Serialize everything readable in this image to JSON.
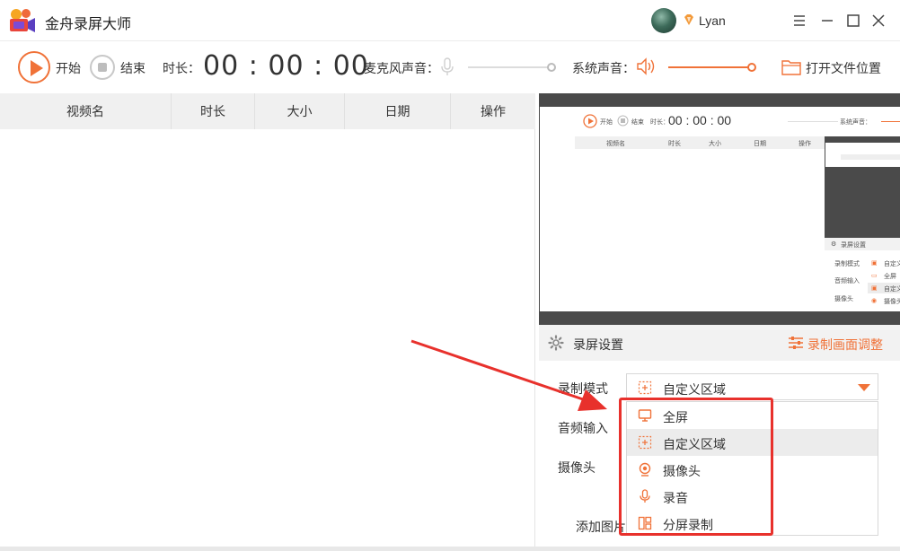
{
  "app": {
    "title": "金舟录屏大师"
  },
  "user": {
    "name": "Lyan"
  },
  "toolbar": {
    "start_label": "开始",
    "stop_label": "结束",
    "duration_label": "时长：",
    "duration_value": "00 : 00 : 00",
    "mic_label": "麦克风声音：",
    "mic_level": 0.0,
    "system_sound_label": "系统声音：",
    "system_level": 1.0,
    "open_folder_label": "打开文件位置"
  },
  "table": {
    "columns": [
      "视频名",
      "时长",
      "大小",
      "日期",
      "操作"
    ]
  },
  "preview": {
    "duration_value": "00 : 00 : 00",
    "start_label": "开始",
    "stop_label": "结束",
    "duration_label": "时长：",
    "system_label": "系统声音：",
    "columns": [
      "视频名",
      "时长",
      "大小",
      "日期",
      "操作"
    ],
    "settings_title": "录屏设置",
    "mode_label": "录制模式",
    "audio_label": "音频输入",
    "camera_label": "摄像头",
    "options": [
      "自定义区域",
      "全屏",
      "自定义区域",
      "摄像头"
    ]
  },
  "settings": {
    "title": "录屏设置",
    "adjust_label": "录制画面调整",
    "mode_label": "录制模式",
    "audio_label": "音频输入",
    "camera_label": "摄像头",
    "add_image_label": "添加图片",
    "selected_mode": "自定义区域",
    "mode_options": [
      {
        "label": "全屏",
        "icon": "monitor-icon"
      },
      {
        "label": "自定义区域",
        "icon": "region-icon"
      },
      {
        "label": "摄像头",
        "icon": "webcam-icon"
      },
      {
        "label": "录音",
        "icon": "mic-icon"
      },
      {
        "label": "分屏录制",
        "icon": "split-screen-icon"
      }
    ]
  },
  "colors": {
    "accent": "#f07238",
    "highlight": "#e8312c"
  }
}
